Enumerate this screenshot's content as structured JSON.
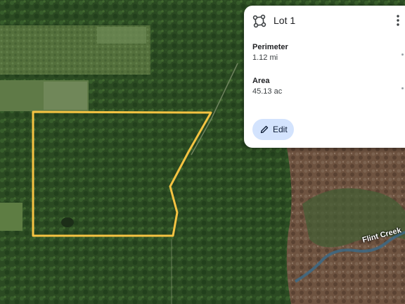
{
  "map": {
    "view": "satellite",
    "boundary_color": "#f5c342",
    "creek_label": "Flint Creek"
  },
  "panel": {
    "title": "Lot 1",
    "perimeter_label": "Perimeter",
    "perimeter_value": "1.12 mi",
    "area_label": "Area",
    "area_value": "45.13 ac",
    "edit_label": "Edit",
    "icons": [
      "polygon-icon",
      "more-vert-icon",
      "pencil-icon"
    ],
    "accent_color": "#d3e3fd"
  }
}
